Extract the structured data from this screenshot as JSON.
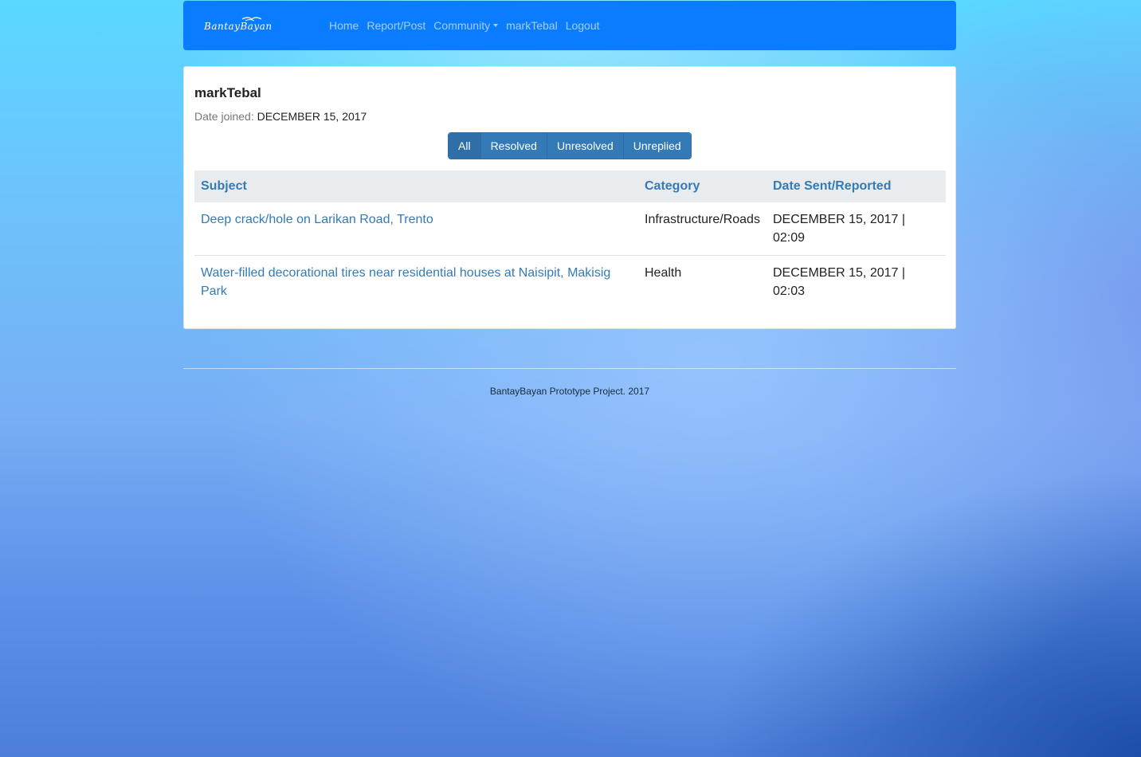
{
  "navbar": {
    "brand": "BantayBayan",
    "links": [
      {
        "label": "Home"
      },
      {
        "label": "Report/Post"
      },
      {
        "label": "Community"
      },
      {
        "label": "markTebal"
      },
      {
        "label": "Logout"
      }
    ]
  },
  "profile": {
    "username": "markTebal",
    "joined_label": "Date joined:",
    "joined_value": "DECEMBER 15, 2017"
  },
  "filters": {
    "buttons": [
      "All",
      "Resolved",
      "Unresolved",
      "Unreplied"
    ],
    "selected": "All"
  },
  "table": {
    "headers": [
      "Subject",
      "Category",
      "Date Sent/Reported"
    ],
    "rows": [
      {
        "subject": "Deep crack/hole on Larikan Road, Trento",
        "category": "Infrastructure/Roads",
        "date": "DECEMBER 15, 2017 | 02:09"
      },
      {
        "subject": "Water-filled decorational tires near residential houses at Naisipit, Makisig Park",
        "category": "Health",
        "date": "DECEMBER 15, 2017 | 02:03"
      }
    ]
  },
  "footer": {
    "text": "BantayBayan Prototype Project. 2017"
  },
  "colors": {
    "navbar": "#0a7cff",
    "button": "#337ab7",
    "link": "#337ab7",
    "table_header_bg": "#e9ecef"
  }
}
